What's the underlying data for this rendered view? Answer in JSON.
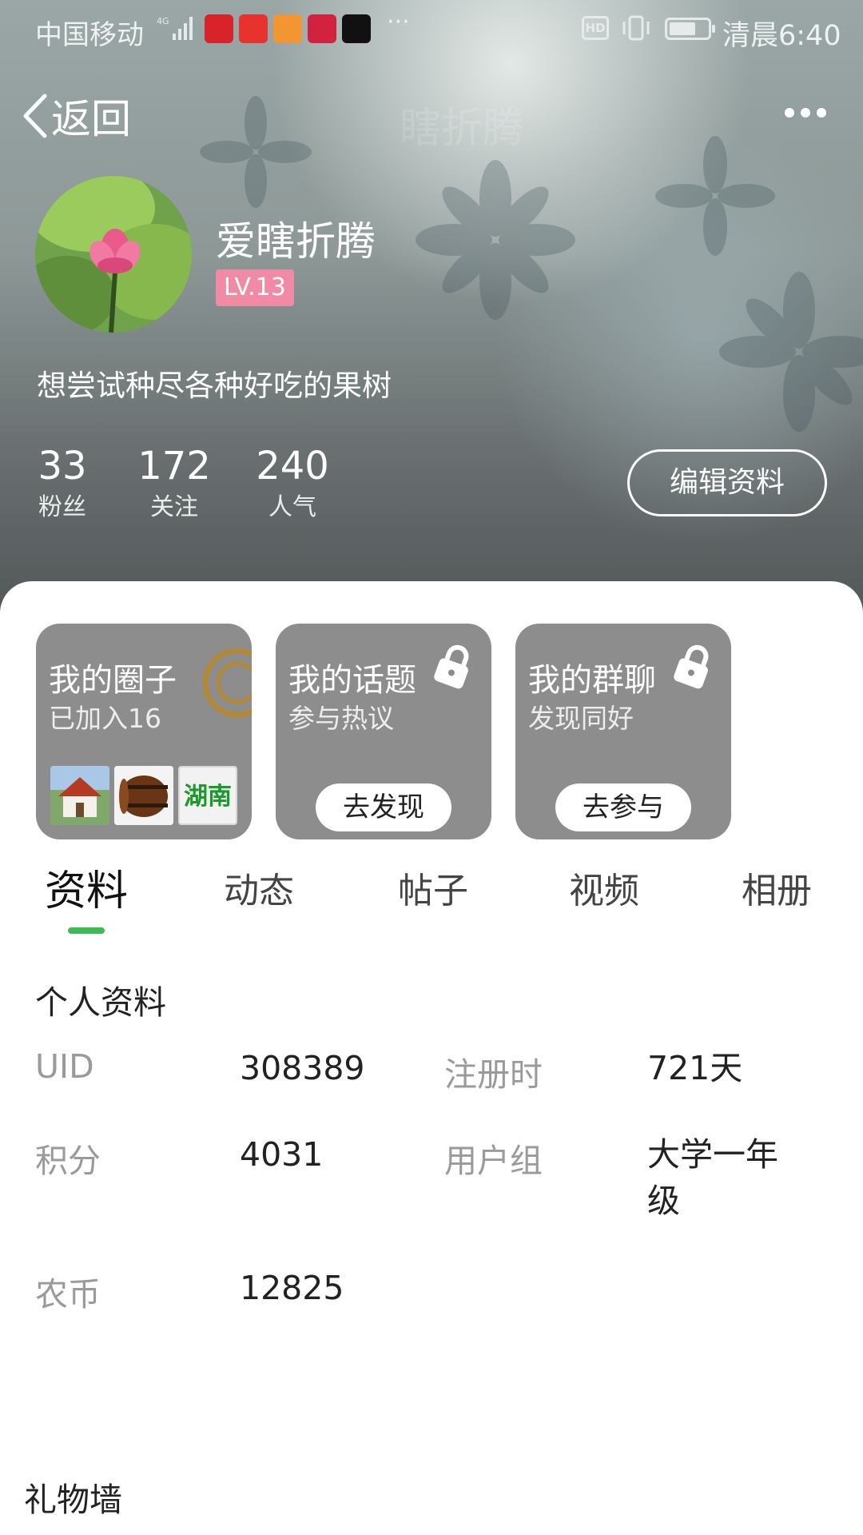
{
  "status_bar": {
    "carrier": "中国移动",
    "network": "4G",
    "time": "清晨6:40",
    "battery_level_percent": 70,
    "more": "···",
    "apps": [
      {
        "name": "特价",
        "color": "#d8232a"
      },
      {
        "name": "头条",
        "color": "#e8322e"
      },
      {
        "name": "video-app-icon",
        "color": "#f29633"
      },
      {
        "name": "lotus-app-icon",
        "color": "#d1233d"
      },
      {
        "name": "capcut-app-icon",
        "color": "#111111"
      }
    ]
  },
  "nav": {
    "back_label": "返回",
    "ghost_title": "瞎折腾"
  },
  "profile": {
    "username": "爱瞎折腾",
    "level": "LV.13",
    "bio": "想尝试种尽各种好吃的果树",
    "stats": [
      {
        "value": "33",
        "label": "粉丝"
      },
      {
        "value": "172",
        "label": "关注"
      },
      {
        "value": "240",
        "label": "人气"
      }
    ],
    "edit_button": "编辑资料"
  },
  "tiles": [
    {
      "title": "我的圈子",
      "subtitle": "已加入16",
      "thumb_text": "湖南",
      "locked": false
    },
    {
      "title": "我的话题",
      "subtitle": "参与热议",
      "button": "去发现",
      "locked": true
    },
    {
      "title": "我的群聊",
      "subtitle": "发现同好",
      "button": "去参与",
      "locked": true
    }
  ],
  "tabs": [
    "资料",
    "动态",
    "帖子",
    "视频",
    "相册"
  ],
  "active_tab": "资料",
  "personal_info": {
    "title": "个人资料",
    "rows": [
      {
        "label": "UID",
        "value": "308389"
      },
      {
        "label": "注册时",
        "value": "721天"
      },
      {
        "label": "积分",
        "value": "4031"
      },
      {
        "label": "用户组",
        "value": "大学一年级"
      },
      {
        "label": "农币",
        "value": "12825"
      }
    ]
  },
  "gift_wall": {
    "title": "礼物墙"
  },
  "colors": {
    "accent": "#3cba54",
    "level_badge": "#f08aa5",
    "tile_bg": "#8d8d8d"
  }
}
